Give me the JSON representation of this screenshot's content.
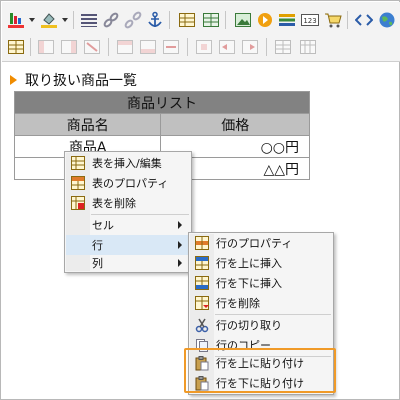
{
  "toolbar": {
    "row1_icons": [
      "text-color-icon",
      "fill-color-icon",
      "horizontal-rule-icon",
      "link-icon",
      "unlink-icon",
      "anchor-icon",
      "table-icon",
      "table-grid-icon",
      "image-icon",
      "media-icon",
      "layers-icon",
      "counter-icon",
      "cart-icon",
      "source-icon",
      "globe-icon"
    ],
    "row2_icons": [
      "table-props-icon",
      "insert-col-left-icon",
      "insert-col-right-icon",
      "delete-col-icon",
      "insert-row-icon",
      "split-cells-icon",
      "merge-cells-icon",
      "cell-props-icon",
      "merge-icon",
      "split-icon",
      "table-view-icon",
      "table-edit-icon"
    ]
  },
  "heading": "取り扱い商品一覧",
  "table": {
    "caption": "商品リスト",
    "headers": [
      "商品名",
      "価格"
    ],
    "rows": [
      [
        "商品A",
        "○○円"
      ],
      [
        "",
        "△△円"
      ]
    ]
  },
  "context_menu": {
    "items": [
      {
        "label": "表を挿入/編集",
        "icon": "table-insert-icon"
      },
      {
        "label": "表のプロパティ",
        "icon": "table-properties-icon"
      },
      {
        "label": "表を削除",
        "icon": "table-delete-icon"
      },
      {
        "label": "セル"
      },
      {
        "label": "行"
      },
      {
        "label": "列"
      }
    ]
  },
  "row_submenu": {
    "items": [
      {
        "label": "行のプロパティ",
        "icon": "row-properties-icon"
      },
      {
        "label": "行を上に挿入",
        "icon": "row-insert-above-icon"
      },
      {
        "label": "行を下に挿入",
        "icon": "row-insert-below-icon"
      },
      {
        "label": "行を削除",
        "icon": "row-delete-icon"
      },
      {
        "label": "行の切り取り",
        "icon": "cut-icon"
      },
      {
        "label": "行のコピー",
        "icon": "copy-icon"
      },
      {
        "label": "行を上に貼り付け",
        "icon": "paste-icon"
      },
      {
        "label": "行を下に貼り付け",
        "icon": "paste-icon"
      }
    ]
  },
  "colors": {
    "highlight": "#f09a28",
    "heading_marker": "#f08c00",
    "active_item": "#d9e8f6",
    "caption_bg": "#828282",
    "header_bg": "#c0c0c0"
  }
}
